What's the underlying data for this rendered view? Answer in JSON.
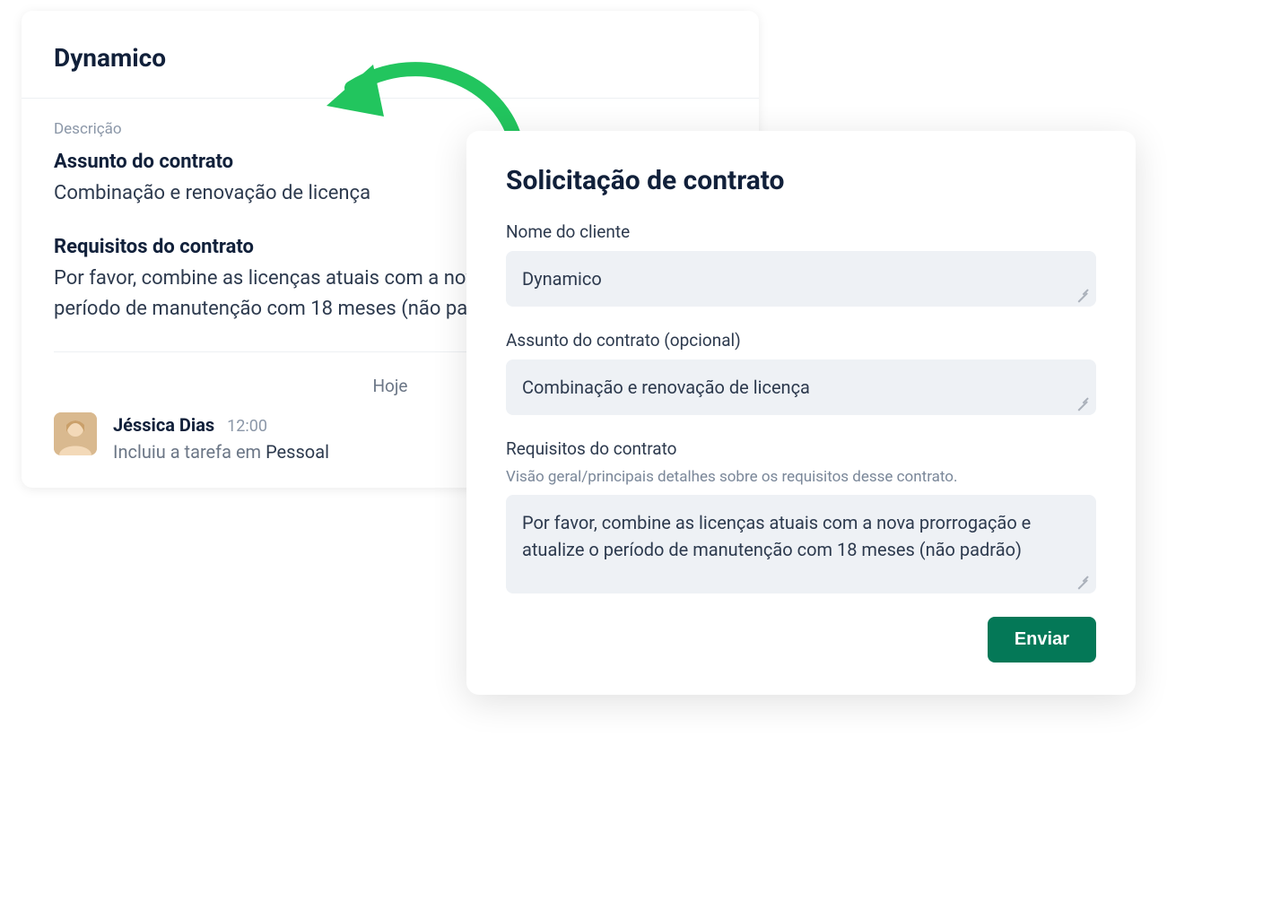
{
  "back_card": {
    "title": "Dynamico",
    "description_label": "Descrição",
    "subject_heading": "Assunto do contrato",
    "subject_body": "Combinação e renovação de licença",
    "requirements_heading": "Requisitos do contrato",
    "requirements_body": "Por favor, combine as licenças atuais com a nova prorrogação e atualize o período de manutenção com 18 meses (não padrão)",
    "today_label": "Hoje",
    "activity": {
      "user_name": "Jéssica Dias",
      "time": "12:00",
      "action_prefix": "Incluiu a tarefa em ",
      "action_target": "Pessoal"
    }
  },
  "front_card": {
    "title": "Solicitação de contrato",
    "client_name_label": "Nome do cliente",
    "client_name_value": "Dynamico",
    "subject_label": "Assunto do contrato (opcional)",
    "subject_value": "Combinação e renovação de licença",
    "requirements_label": "Requisitos do contrato",
    "requirements_helper": "Visão geral/principais detalhes sobre os requisitos desse contrato.",
    "requirements_value": "Por favor, combine as licenças atuais com a nova prorrogação e atualize o período de manutenção com 18 meses (não padrão)",
    "submit_label": "Enviar"
  },
  "colors": {
    "accent_green": "#047857",
    "arrow_green": "#22c55e"
  }
}
